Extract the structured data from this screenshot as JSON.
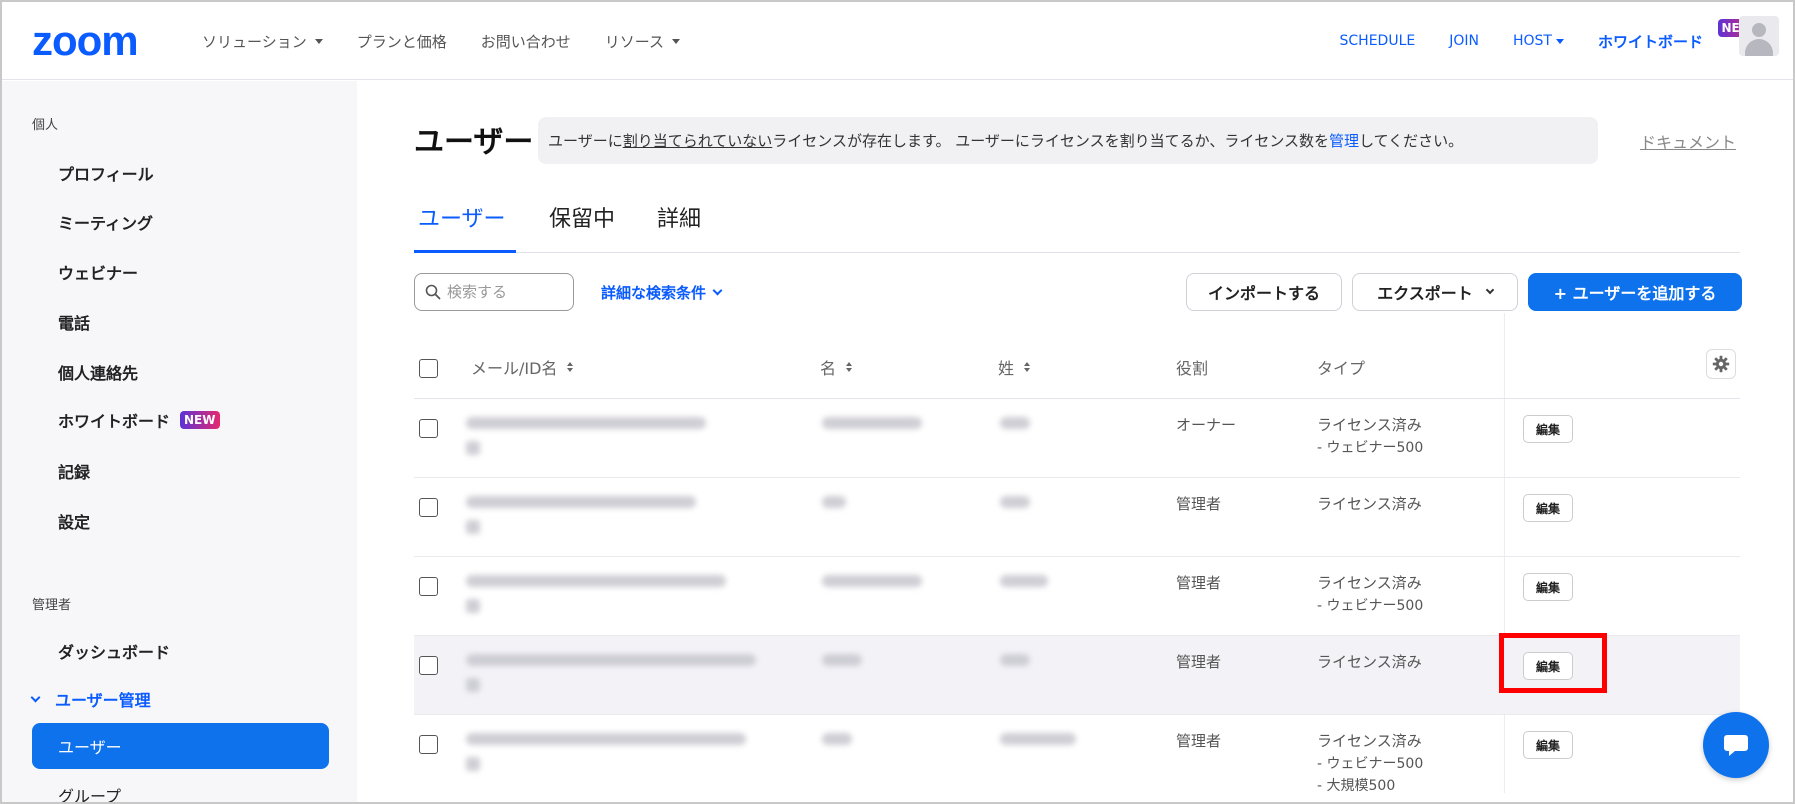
{
  "brand": {
    "logo": "zoom"
  },
  "nav": {
    "left": [
      "ソリューション",
      "プランと価格",
      "お問い合わせ",
      "リソース"
    ],
    "right": [
      "SCHEDULE",
      "JOIN",
      "HOST"
    ],
    "whiteboard": "ホワイトボード",
    "new_badge": "NEW"
  },
  "sidebar": {
    "personal_section": "個人",
    "personal_items": [
      "プロフィール",
      "ミーティング",
      "ウェビナー",
      "電話",
      "個人連絡先",
      "ホワイトボード",
      "記録",
      "設定"
    ],
    "new_badge": "NEW",
    "admin_section": "管理者",
    "admin_items": [
      "ダッシュボード",
      "ユーザー管理",
      "ユーザー",
      "グループ"
    ]
  },
  "page": {
    "title": "ユーザー",
    "banner": {
      "part1": "ユーザーに",
      "underlined": "割り当てられていない",
      "part2": "ライセンスが存在します。 ユーザーにライセンスを割り当てるか、ライセンス数を",
      "link": "管理",
      "part3": "してください。"
    },
    "doc_link": "ドキュメント",
    "tabs": [
      "ユーザー",
      "保留中",
      "詳細"
    ],
    "search_placeholder": "検索する",
    "advanced_filter": "詳細な検索条件",
    "import_label": "インポートする",
    "export_label": "エクスポート",
    "add_user_label": "+ ユーザーを追加する"
  },
  "table": {
    "headers": [
      "メール/ID名",
      "名",
      "姓",
      "役割",
      "タイプ"
    ],
    "edit_label": "編集",
    "rows": [
      {
        "role": "オーナー",
        "type": "ライセンス済み",
        "type_sub": [
          "- ウェビナー500"
        ]
      },
      {
        "role": "管理者",
        "type": "ライセンス済み",
        "type_sub": []
      },
      {
        "role": "管理者",
        "type": "ライセンス済み",
        "type_sub": [
          "- ウェビナー500"
        ]
      },
      {
        "role": "管理者",
        "type": "ライセンス済み",
        "type_sub": []
      },
      {
        "role": "管理者",
        "type": "ライセンス済み",
        "type_sub": [
          "- ウェビナー500",
          "- 大規模500"
        ]
      }
    ]
  },
  "colors": {
    "accent": "#0b5cff",
    "primary_button": "#0e72ed",
    "callout": "#ff0000"
  },
  "icons": {
    "search": "search-icon",
    "gear": "gear-icon",
    "chat": "chat-icon"
  }
}
